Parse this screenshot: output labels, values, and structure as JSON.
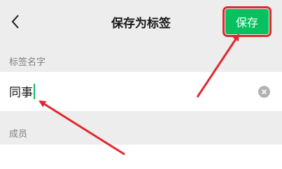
{
  "header": {
    "back_icon": "chevron-left-icon",
    "title": "保存为标签",
    "save_label": "保存"
  },
  "tag_name": {
    "label": "标签名字",
    "value": "同事",
    "clear_icon": "clear-circle-icon"
  },
  "members": {
    "label": "成员"
  },
  "colors": {
    "accent": "#07C160",
    "background": "#EDEDED",
    "annotation": "#E0282E"
  }
}
